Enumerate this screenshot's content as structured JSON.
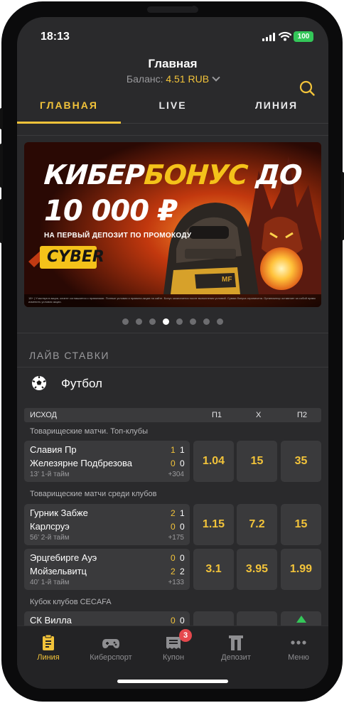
{
  "status": {
    "time": "18:13",
    "battery": "100"
  },
  "header": {
    "title": "Главная",
    "balance_label": "Баланс:",
    "balance_value": "4.51 RUB"
  },
  "tabs": [
    {
      "label": "ГЛАВНАЯ",
      "active": true
    },
    {
      "label": "LIVE",
      "active": false
    },
    {
      "label": "ЛИНИЯ",
      "active": false
    }
  ],
  "banner": {
    "line1_white": "КИБЕР",
    "line1_yellow": "БОНУС",
    "line1_tail": " ДО",
    "line2": "10 000 ₽",
    "line3": "НА ПЕРВЫЙ ДЕПОЗИТ ПО ПРОМОКОДУ",
    "promo_code": "CYBER",
    "fine_print": "18+ | Участвуя в акции, клиент соглашается с правилами. Полные условия и правила акции на сайте. Бонус зачисляется после выполнения условий. Сумма бонуса ограничена. Организатор оставляет за собой право изменить условия акции."
  },
  "carousel": {
    "count": 8,
    "active_index": 3
  },
  "live_section": {
    "title": "ЛАЙВ СТАВКИ",
    "sport": "Футбол",
    "columns": {
      "outcome": "ИСХОД",
      "p1": "П1",
      "x": "Х",
      "p2": "П2"
    }
  },
  "leagues": [
    {
      "name": "Товарищеские матчи. Топ-клубы",
      "matches": [
        {
          "team1": "Славия Пр",
          "team2": "Железярне Подбрезова",
          "s1a": "1",
          "s1b": "1",
          "s2a": "0",
          "s2b": "0",
          "period": "13' 1-й тайм",
          "more": "+304",
          "p1": "1.04",
          "x": "15",
          "p2": "35"
        }
      ]
    },
    {
      "name": "Товарищеские матчи среди клубов",
      "matches": [
        {
          "team1": "Гурник Забже",
          "team2": "Карлсруэ",
          "s1a": "2",
          "s1b": "1",
          "s2a": "0",
          "s2b": "0",
          "period": "56' 2-й тайм",
          "more": "+175",
          "p1": "1.15",
          "x": "7.2",
          "p2": "15"
        },
        {
          "team1": "Эрцгебирге Ауэ",
          "team2": "Мойзельвитц",
          "s1a": "0",
          "s1b": "0",
          "s2a": "2",
          "s2b": "2",
          "period": "40' 1-й тайм",
          "more": "+133",
          "p1": "3.1",
          "x": "3.95",
          "p2": "1.99"
        }
      ]
    },
    {
      "name": "Кубок клубов CECAFA",
      "matches": [
        {
          "team1": "СК Вилла",
          "s1a": "0",
          "s1b": "0"
        }
      ]
    }
  ],
  "tabbar": [
    {
      "label": "Линия",
      "icon": "clipboard-icon",
      "active": true
    },
    {
      "label": "Киберспорт",
      "icon": "gamepad-icon",
      "active": false
    },
    {
      "label": "Купон",
      "icon": "ticket-icon",
      "active": false,
      "badge": "3"
    },
    {
      "label": "Депозит",
      "icon": "wallet-icon",
      "active": false
    },
    {
      "label": "Меню",
      "icon": "more-icon",
      "active": false
    }
  ],
  "colors": {
    "accent": "#f2c33a",
    "background": "#2a2a2c",
    "card": "#3a3a3c",
    "badge": "#e5484d",
    "up_arrow": "#34c759"
  }
}
